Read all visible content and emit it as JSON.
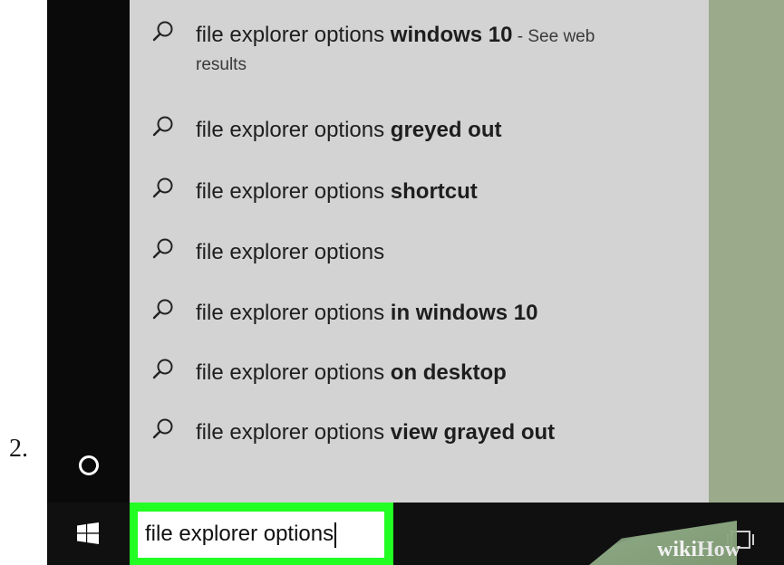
{
  "step_number": "2.",
  "suggestions": [
    {
      "prefix": "file explorer options ",
      "bold": "windows 10",
      "suffix": " - See web",
      "extra_line": "results"
    },
    {
      "prefix": "file explorer options ",
      "bold": "greyed out",
      "suffix": "",
      "extra_line": ""
    },
    {
      "prefix": "file explorer options ",
      "bold": "shortcut",
      "suffix": "",
      "extra_line": ""
    },
    {
      "prefix": "file explorer options",
      "bold": "",
      "suffix": "",
      "extra_line": ""
    },
    {
      "prefix": "file explorer options ",
      "bold": "in windows 10",
      "suffix": "",
      "extra_line": ""
    },
    {
      "prefix": "file explorer options ",
      "bold": "on desktop",
      "suffix": "",
      "extra_line": ""
    },
    {
      "prefix": "file explorer options ",
      "bold": "view grayed out",
      "suffix": "",
      "extra_line": ""
    }
  ],
  "search": {
    "value": "file explorer options"
  },
  "icons": {
    "suggestion": "search-icon",
    "cortana": "cortana-circle-icon",
    "start": "windows-logo-icon",
    "task_view": "task-view-icon"
  },
  "watermark": {
    "wiki": "wiki",
    "how": "How"
  },
  "colors": {
    "panel": "#d3d3d3",
    "rail": "#0a0a0a",
    "taskbar": "#101010",
    "highlight": "#22ff22",
    "desktop": "#9aaa8a"
  }
}
